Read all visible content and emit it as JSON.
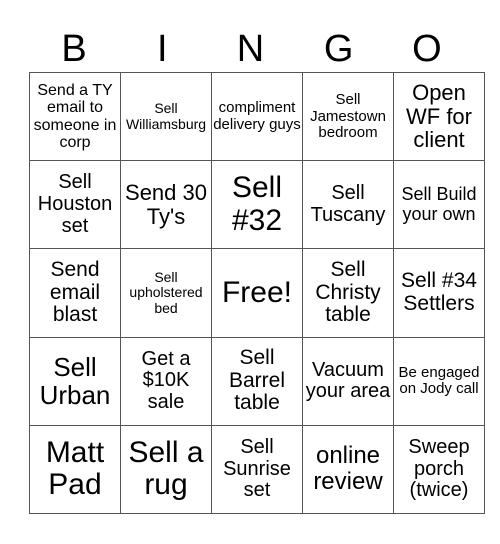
{
  "header": {
    "letters": [
      "B",
      "I",
      "N",
      "G",
      "O"
    ]
  },
  "board": {
    "rows": [
      [
        "Send a TY email to someone in corp",
        "Sell Williamsburg",
        "compliment delivery guys",
        "Sell Jamestown bedroom",
        "Open WF for client"
      ],
      [
        "Sell Houston set",
        "Send 30 Ty's",
        "Sell #32",
        "Sell Tuscany",
        "Sell Build your own"
      ],
      [
        "Send email blast",
        "Sell upholstered bed",
        "Free!",
        "Sell Christy table",
        "Sell #34 Settlers"
      ],
      [
        "Sell Urban",
        "Get a $10K sale",
        "Sell Barrel table",
        "Vacuum your area",
        "Be engaged on Jody call"
      ],
      [
        "Matt Pad",
        "Sell a rug",
        "Sell Sunrise set",
        "online review",
        "Sweep porch (twice)"
      ]
    ],
    "free_space": "Free!"
  },
  "colors": {
    "grid_line": "#555555",
    "text": "#000000",
    "background": "#ffffff"
  }
}
